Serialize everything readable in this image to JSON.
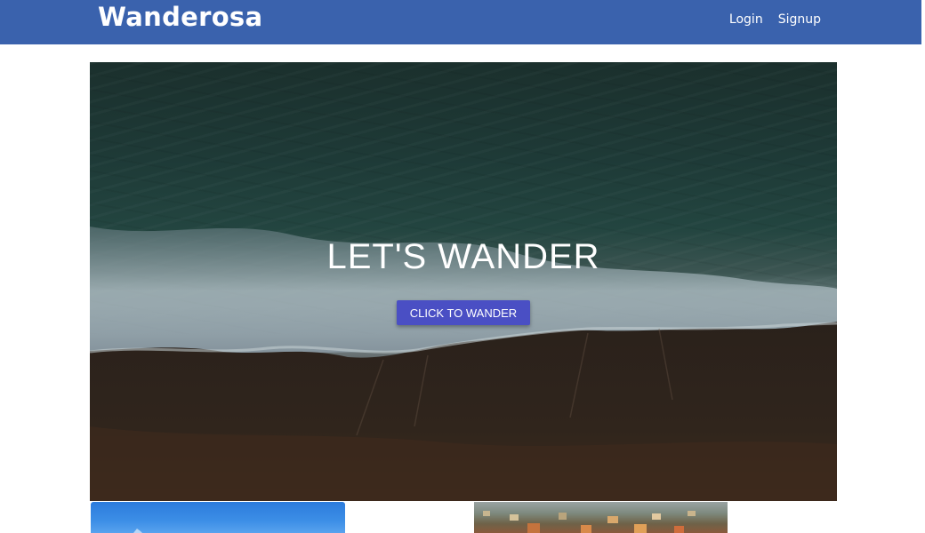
{
  "navbar": {
    "brand": "Wanderosa",
    "links": [
      {
        "label": "Login"
      },
      {
        "label": "Signup"
      }
    ],
    "background": "#3a62ad"
  },
  "hero": {
    "title": "LET'S WANDER",
    "button_label": "CLICK TO WANDER",
    "button_color": "#4a4fc4"
  },
  "cards": [
    {
      "image": "blue-sky-photo"
    },
    {
      "image": "coastal-town-photo"
    }
  ]
}
